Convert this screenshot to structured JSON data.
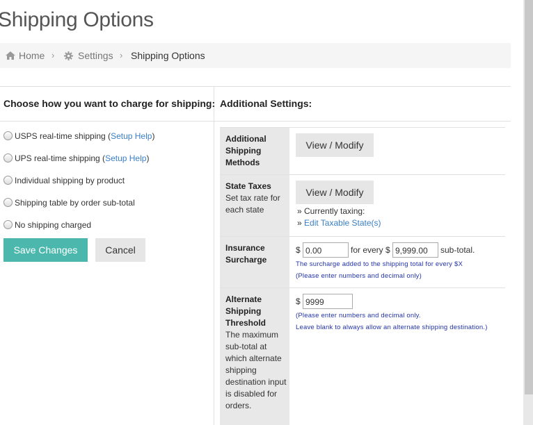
{
  "page": {
    "title": "Shipping Options"
  },
  "breadcrumb": {
    "home": "Home",
    "settings": "Settings",
    "current": "Shipping Options"
  },
  "left": {
    "heading": "Choose how you want to charge for shipping:",
    "options": [
      {
        "text": "USPS real-time shipping (",
        "link": "Setup Help",
        "after": ")"
      },
      {
        "text": "UPS real-time shipping (",
        "link": "Setup Help",
        "after": ")"
      },
      {
        "text": "Individual shipping by product"
      },
      {
        "text": "Shipping table by order sub-total"
      },
      {
        "text": "No shipping charged"
      }
    ],
    "save_label": "Save Changes",
    "cancel_label": "Cancel"
  },
  "right": {
    "heading": "Additional Settings:",
    "methods": {
      "label": "Additional Shipping Methods",
      "button": "View / Modify"
    },
    "taxes": {
      "label": "State Taxes",
      "desc": "Set tax rate for each state",
      "button": "View / Modify",
      "currently": "» Currently taxing:",
      "edit_prefix": "» ",
      "edit_link": "Edit Taxable State(s)"
    },
    "insurance": {
      "label": "Insurance Surcharge",
      "dollar1": "$",
      "amount": "0.00",
      "for_every": "for every $",
      "subtotal_value": "9,999.00",
      "subtotal_text": "sub-total.",
      "note1": "The surcharge added to the shipping total for every $X",
      "note2": "(Please enter numbers and decimal only)"
    },
    "threshold": {
      "label": "Alternate Shipping Threshold",
      "desc": "The maximum sub-total at which alternate shipping destination input is disabled for orders.",
      "dollar": "$",
      "value": "9999",
      "note1": "(Please enter numbers and decimal only.",
      "note2": "Leave blank to always allow an alternate shipping destination.)"
    }
  },
  "colors": {
    "accent": "#4cb8ad",
    "link": "#3a7fc4",
    "note": "#2233aa"
  }
}
